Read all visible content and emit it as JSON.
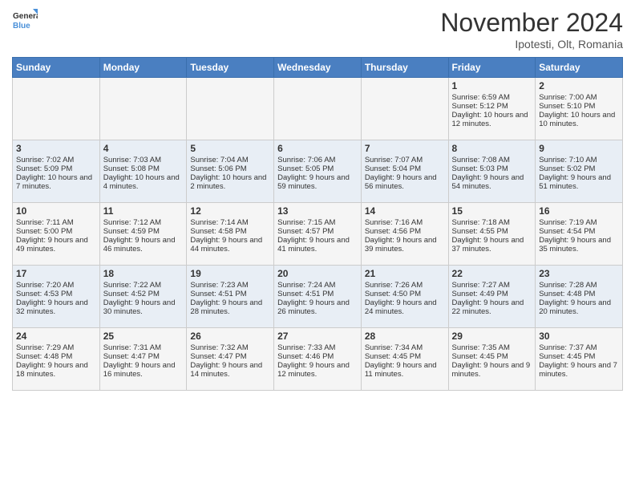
{
  "header": {
    "logo_general": "General",
    "logo_blue": "Blue",
    "month_title": "November 2024",
    "subtitle": "Ipotesti, Olt, Romania"
  },
  "days_of_week": [
    "Sunday",
    "Monday",
    "Tuesday",
    "Wednesday",
    "Thursday",
    "Friday",
    "Saturday"
  ],
  "weeks": [
    [
      {
        "day": "",
        "sunrise": "",
        "sunset": "",
        "daylight": ""
      },
      {
        "day": "",
        "sunrise": "",
        "sunset": "",
        "daylight": ""
      },
      {
        "day": "",
        "sunrise": "",
        "sunset": "",
        "daylight": ""
      },
      {
        "day": "",
        "sunrise": "",
        "sunset": "",
        "daylight": ""
      },
      {
        "day": "",
        "sunrise": "",
        "sunset": "",
        "daylight": ""
      },
      {
        "day": "1",
        "sunrise": "Sunrise: 6:59 AM",
        "sunset": "Sunset: 5:12 PM",
        "daylight": "Daylight: 10 hours and 12 minutes."
      },
      {
        "day": "2",
        "sunrise": "Sunrise: 7:00 AM",
        "sunset": "Sunset: 5:10 PM",
        "daylight": "Daylight: 10 hours and 10 minutes."
      }
    ],
    [
      {
        "day": "3",
        "sunrise": "Sunrise: 7:02 AM",
        "sunset": "Sunset: 5:09 PM",
        "daylight": "Daylight: 10 hours and 7 minutes."
      },
      {
        "day": "4",
        "sunrise": "Sunrise: 7:03 AM",
        "sunset": "Sunset: 5:08 PM",
        "daylight": "Daylight: 10 hours and 4 minutes."
      },
      {
        "day": "5",
        "sunrise": "Sunrise: 7:04 AM",
        "sunset": "Sunset: 5:06 PM",
        "daylight": "Daylight: 10 hours and 2 minutes."
      },
      {
        "day": "6",
        "sunrise": "Sunrise: 7:06 AM",
        "sunset": "Sunset: 5:05 PM",
        "daylight": "Daylight: 9 hours and 59 minutes."
      },
      {
        "day": "7",
        "sunrise": "Sunrise: 7:07 AM",
        "sunset": "Sunset: 5:04 PM",
        "daylight": "Daylight: 9 hours and 56 minutes."
      },
      {
        "day": "8",
        "sunrise": "Sunrise: 7:08 AM",
        "sunset": "Sunset: 5:03 PM",
        "daylight": "Daylight: 9 hours and 54 minutes."
      },
      {
        "day": "9",
        "sunrise": "Sunrise: 7:10 AM",
        "sunset": "Sunset: 5:02 PM",
        "daylight": "Daylight: 9 hours and 51 minutes."
      }
    ],
    [
      {
        "day": "10",
        "sunrise": "Sunrise: 7:11 AM",
        "sunset": "Sunset: 5:00 PM",
        "daylight": "Daylight: 9 hours and 49 minutes."
      },
      {
        "day": "11",
        "sunrise": "Sunrise: 7:12 AM",
        "sunset": "Sunset: 4:59 PM",
        "daylight": "Daylight: 9 hours and 46 minutes."
      },
      {
        "day": "12",
        "sunrise": "Sunrise: 7:14 AM",
        "sunset": "Sunset: 4:58 PM",
        "daylight": "Daylight: 9 hours and 44 minutes."
      },
      {
        "day": "13",
        "sunrise": "Sunrise: 7:15 AM",
        "sunset": "Sunset: 4:57 PM",
        "daylight": "Daylight: 9 hours and 41 minutes."
      },
      {
        "day": "14",
        "sunrise": "Sunrise: 7:16 AM",
        "sunset": "Sunset: 4:56 PM",
        "daylight": "Daylight: 9 hours and 39 minutes."
      },
      {
        "day": "15",
        "sunrise": "Sunrise: 7:18 AM",
        "sunset": "Sunset: 4:55 PM",
        "daylight": "Daylight: 9 hours and 37 minutes."
      },
      {
        "day": "16",
        "sunrise": "Sunrise: 7:19 AM",
        "sunset": "Sunset: 4:54 PM",
        "daylight": "Daylight: 9 hours and 35 minutes."
      }
    ],
    [
      {
        "day": "17",
        "sunrise": "Sunrise: 7:20 AM",
        "sunset": "Sunset: 4:53 PM",
        "daylight": "Daylight: 9 hours and 32 minutes."
      },
      {
        "day": "18",
        "sunrise": "Sunrise: 7:22 AM",
        "sunset": "Sunset: 4:52 PM",
        "daylight": "Daylight: 9 hours and 30 minutes."
      },
      {
        "day": "19",
        "sunrise": "Sunrise: 7:23 AM",
        "sunset": "Sunset: 4:51 PM",
        "daylight": "Daylight: 9 hours and 28 minutes."
      },
      {
        "day": "20",
        "sunrise": "Sunrise: 7:24 AM",
        "sunset": "Sunset: 4:51 PM",
        "daylight": "Daylight: 9 hours and 26 minutes."
      },
      {
        "day": "21",
        "sunrise": "Sunrise: 7:26 AM",
        "sunset": "Sunset: 4:50 PM",
        "daylight": "Daylight: 9 hours and 24 minutes."
      },
      {
        "day": "22",
        "sunrise": "Sunrise: 7:27 AM",
        "sunset": "Sunset: 4:49 PM",
        "daylight": "Daylight: 9 hours and 22 minutes."
      },
      {
        "day": "23",
        "sunrise": "Sunrise: 7:28 AM",
        "sunset": "Sunset: 4:48 PM",
        "daylight": "Daylight: 9 hours and 20 minutes."
      }
    ],
    [
      {
        "day": "24",
        "sunrise": "Sunrise: 7:29 AM",
        "sunset": "Sunset: 4:48 PM",
        "daylight": "Daylight: 9 hours and 18 minutes."
      },
      {
        "day": "25",
        "sunrise": "Sunrise: 7:31 AM",
        "sunset": "Sunset: 4:47 PM",
        "daylight": "Daylight: 9 hours and 16 minutes."
      },
      {
        "day": "26",
        "sunrise": "Sunrise: 7:32 AM",
        "sunset": "Sunset: 4:47 PM",
        "daylight": "Daylight: 9 hours and 14 minutes."
      },
      {
        "day": "27",
        "sunrise": "Sunrise: 7:33 AM",
        "sunset": "Sunset: 4:46 PM",
        "daylight": "Daylight: 9 hours and 12 minutes."
      },
      {
        "day": "28",
        "sunrise": "Sunrise: 7:34 AM",
        "sunset": "Sunset: 4:45 PM",
        "daylight": "Daylight: 9 hours and 11 minutes."
      },
      {
        "day": "29",
        "sunrise": "Sunrise: 7:35 AM",
        "sunset": "Sunset: 4:45 PM",
        "daylight": "Daylight: 9 hours and 9 minutes."
      },
      {
        "day": "30",
        "sunrise": "Sunrise: 7:37 AM",
        "sunset": "Sunset: 4:45 PM",
        "daylight": "Daylight: 9 hours and 7 minutes."
      }
    ]
  ]
}
